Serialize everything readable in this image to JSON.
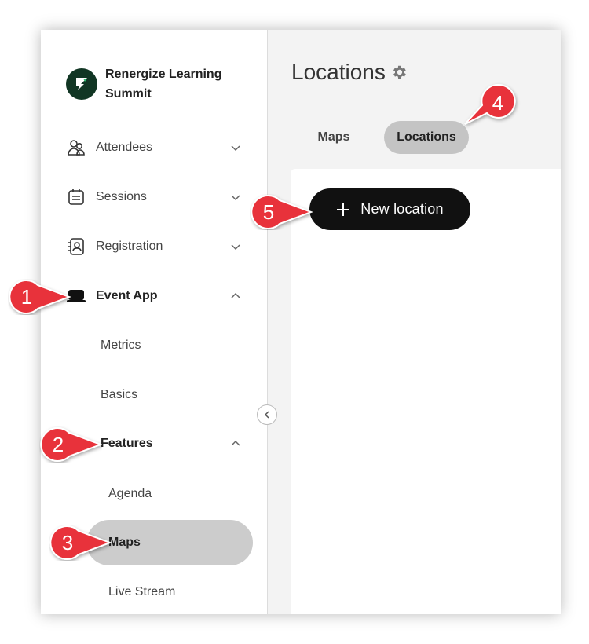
{
  "brand": {
    "name": "Renergize Learning Summit"
  },
  "sidebar": {
    "items": [
      {
        "label": "Attendees",
        "icon": "people-icon",
        "expanded": false
      },
      {
        "label": "Sessions",
        "icon": "calendar-icon",
        "expanded": false
      },
      {
        "label": "Registration",
        "icon": "contact-book-icon",
        "expanded": false
      },
      {
        "label": "Event App",
        "icon": "event-app-icon",
        "expanded": true
      }
    ],
    "event_app_children": [
      "Metrics",
      "Basics",
      "Features"
    ],
    "features_children": [
      "Agenda",
      "Maps",
      "Live Stream"
    ],
    "active_item": "Maps"
  },
  "main": {
    "title": "Locations",
    "tabs": [
      {
        "label": "Maps",
        "selected": false
      },
      {
        "label": "Locations",
        "selected": true
      }
    ],
    "new_button_label": "New location"
  },
  "callouts": [
    "1",
    "2",
    "3",
    "4",
    "5"
  ],
  "colors": {
    "callout": "#e8323a",
    "active_pill": "#cccccc",
    "selected_tab": "#c4c4c4",
    "primary_button": "#111111",
    "brand_logo": "#113624"
  }
}
